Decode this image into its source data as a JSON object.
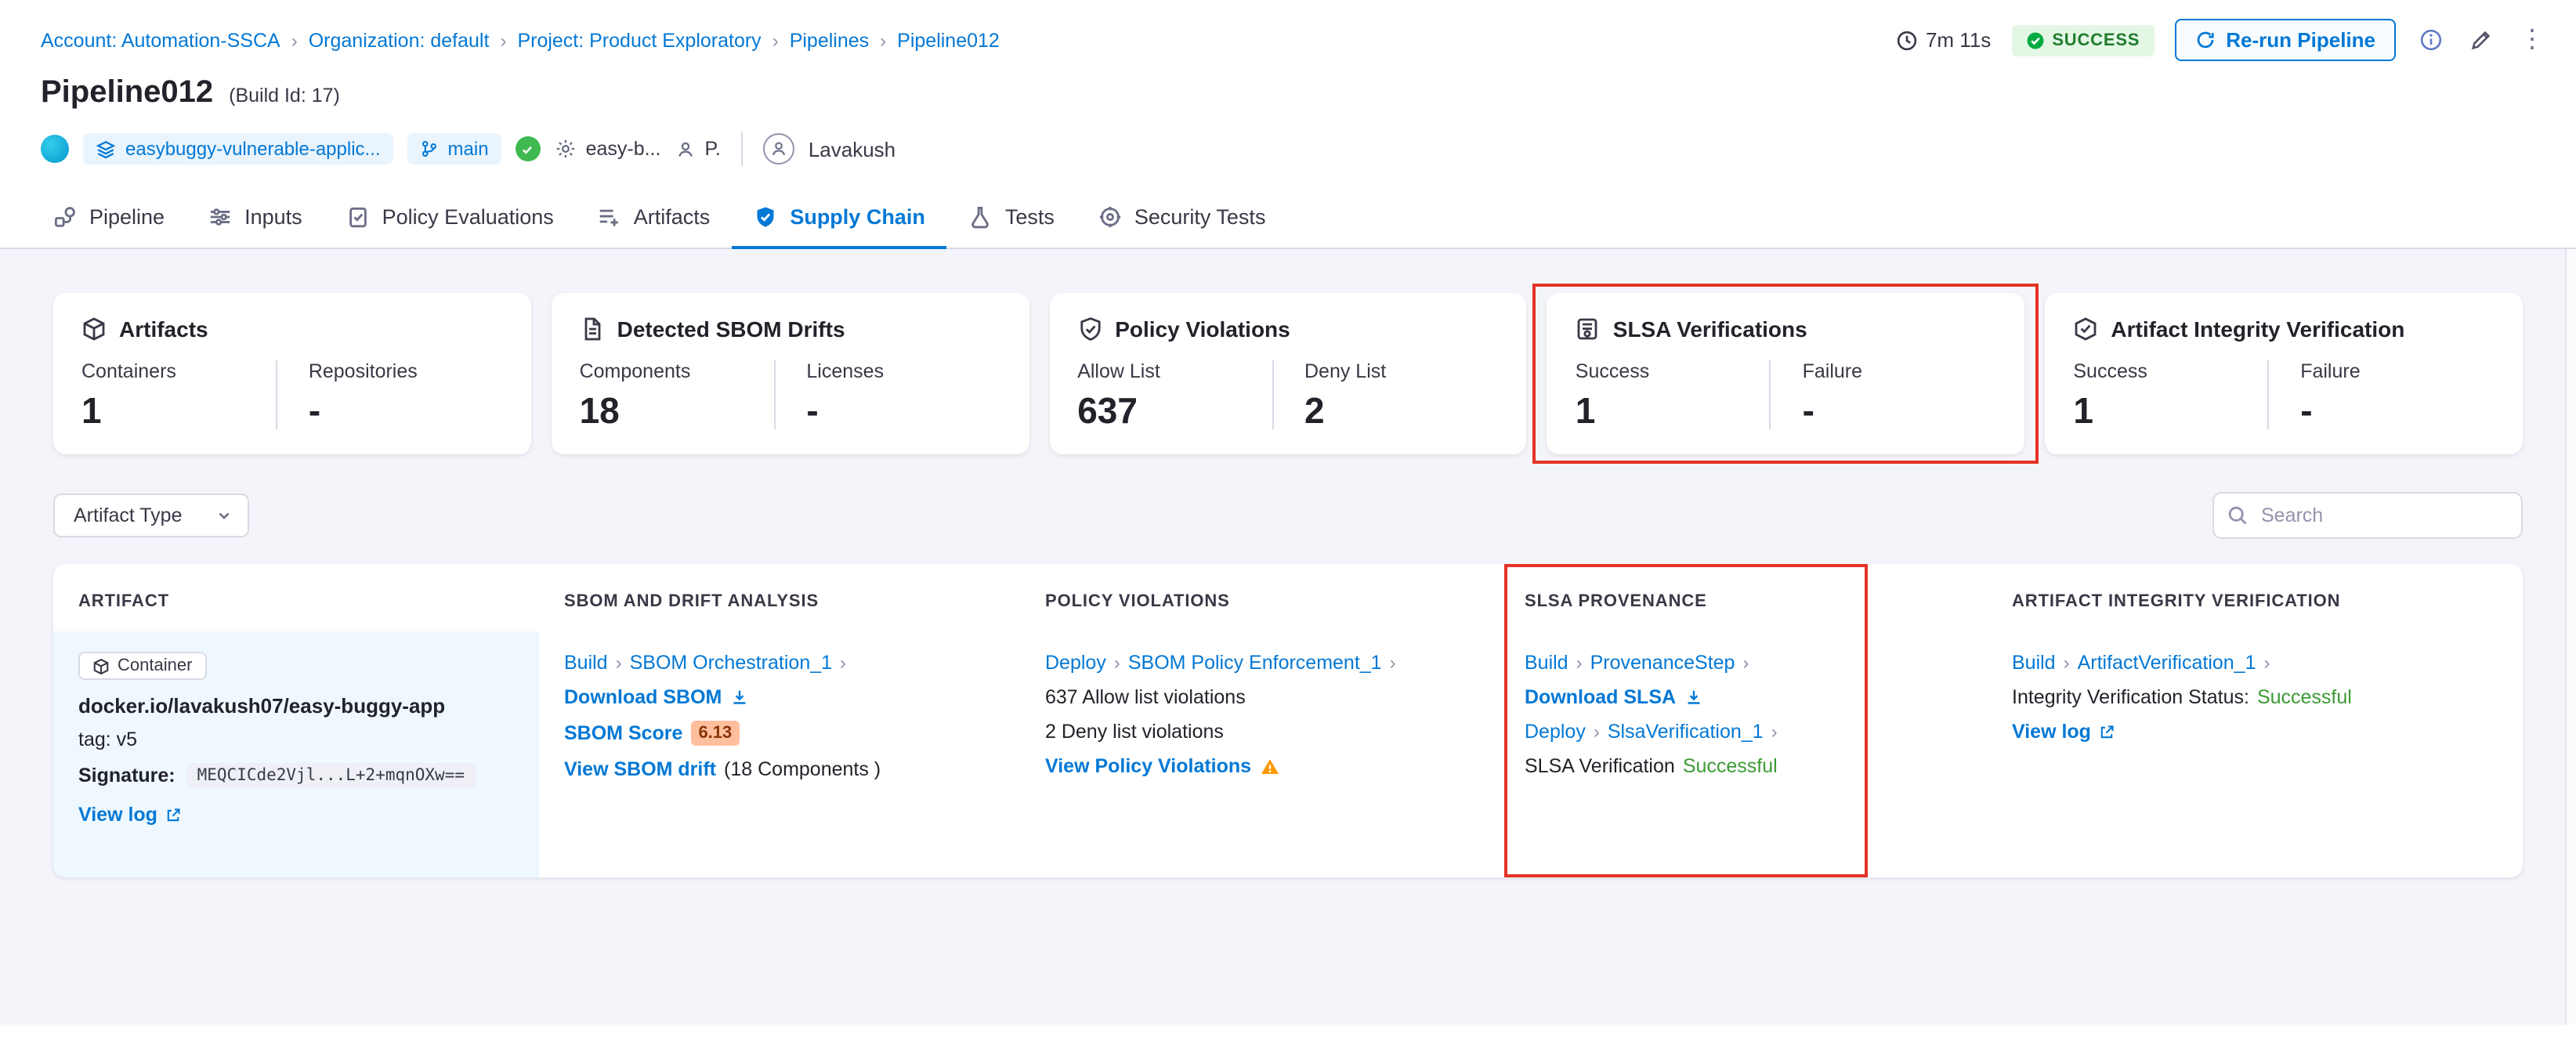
{
  "colors": {
    "accent": "#0278d5",
    "dark": "#22222a",
    "muted": "#6b6d85",
    "border": "#d9dae5",
    "page-bg": "#f4f5fa",
    "success-badge-bg": "#e4f7e5",
    "success-badge-text": "#1e7d2e",
    "success-text": "#3d9a35",
    "warning": "#ff9800",
    "annotation-red": "#e43326",
    "score-badge-bg": "#ffbf9e",
    "score-badge-text": "#8a3407"
  },
  "breadcrumb": {
    "items": [
      "Account: Automation-SSCA",
      "Organization: default",
      "Project: Product Exploratory",
      "Pipelines",
      "Pipeline012"
    ]
  },
  "header": {
    "duration": "7m 11s",
    "status": "SUCCESS",
    "rerun_label": "Re-run Pipeline",
    "title": "Pipeline012",
    "build_id": "(Build Id: 17)",
    "repo_name": "easybuggy-vulnerable-applic...",
    "branch": "main",
    "context_name": "easy-b...",
    "trigger_initial": "P.",
    "user_name": "Lavakush"
  },
  "tabs": [
    {
      "label": "Pipeline"
    },
    {
      "label": "Inputs"
    },
    {
      "label": "Policy Evaluations"
    },
    {
      "label": "Artifacts"
    },
    {
      "label": "Supply Chain"
    },
    {
      "label": "Tests"
    },
    {
      "label": "Security Tests"
    }
  ],
  "summary_cards": [
    {
      "title": "Artifacts",
      "cols": [
        {
          "label": "Containers",
          "value": "1"
        },
        {
          "label": "Repositories",
          "value": "-"
        }
      ]
    },
    {
      "title": "Detected SBOM Drifts",
      "cols": [
        {
          "label": "Components",
          "value": "18"
        },
        {
          "label": "Licenses",
          "value": "-"
        }
      ]
    },
    {
      "title": "Policy Violations",
      "cols": [
        {
          "label": "Allow List",
          "value": "637"
        },
        {
          "label": "Deny List",
          "value": "2"
        }
      ]
    },
    {
      "title": "SLSA Verifications",
      "cols": [
        {
          "label": "Success",
          "value": "1"
        },
        {
          "label": "Failure",
          "value": "-"
        }
      ]
    },
    {
      "title": "Artifact Integrity Verification",
      "cols": [
        {
          "label": "Success",
          "value": "1"
        },
        {
          "label": "Failure",
          "value": "-"
        }
      ]
    }
  ],
  "filters": {
    "artifact_type_label": "Artifact Type",
    "search_placeholder": "Search"
  },
  "table": {
    "columns": [
      "ARTIFACT",
      "SBOM AND DRIFT ANALYSIS",
      "POLICY VIOLATIONS",
      "SLSA PROVENANCE",
      "ARTIFACT INTEGRITY VERIFICATION"
    ],
    "row": {
      "artifact": {
        "type_badge": "Container",
        "image_name": "docker.io/lavakush07/easy-buggy-app",
        "tag": "tag: v5",
        "signature_label": "Signature:",
        "signature_value": "MEQCICde2Vjl...L+2+mqnOXw==",
        "view_log_label": "View log"
      },
      "sbom": {
        "stage": "Build",
        "step": "SBOM Orchestration_1",
        "download_label": "Download SBOM",
        "score_label": "SBOM Score",
        "score_value": "6.13",
        "drift_link": "View SBOM drift",
        "drift_suffix": "(18 Components )"
      },
      "policy": {
        "stage": "Deploy",
        "step": "SBOM Policy Enforcement_1",
        "allow_text": "637 Allow list violations",
        "deny_text": "2 Deny list violations",
        "view_link": "View Policy Violations"
      },
      "slsa": {
        "stage1": "Build",
        "step1": "ProvenanceStep",
        "download_label": "Download SLSA",
        "stage2": "Deploy",
        "step2": "SlsaVerification_1",
        "status_label": "SLSA Verification",
        "status_value": "Successful"
      },
      "integrity": {
        "stage": "Build",
        "step": "ArtifactVerification_1",
        "status_label": "Integrity Verification Status:",
        "status_value": "Successful",
        "view_log_label": "View log"
      }
    }
  }
}
